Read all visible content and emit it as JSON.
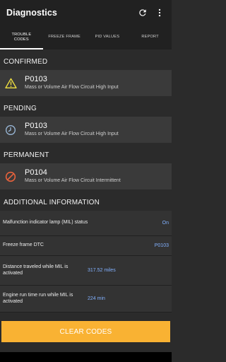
{
  "app": {
    "title": "Diagnostics"
  },
  "icons": {
    "refresh": "refresh-icon",
    "menu": "more-vert-icon"
  },
  "tabs": [
    {
      "label": "TROUBLE\nCODES",
      "active": true
    },
    {
      "label": "FREEZE FRAME"
    },
    {
      "label": "PID VALUES"
    },
    {
      "label": "REPORT"
    }
  ],
  "sections": {
    "confirmed": {
      "title": "CONFIRMED",
      "code": "P0103",
      "description": "Mass or Volume Air Flow Circuit High Input",
      "icon": "warning-icon"
    },
    "pending": {
      "title": "PENDING",
      "code": "P0103",
      "description": "Mass or Volume Air Flow Circuit High Input",
      "icon": "clock-icon"
    },
    "permanent": {
      "title": "PERMANENT",
      "code": "P0104",
      "description": "Mass or Volume Air Flow Circuit Intermittent",
      "icon": "prohibited-icon"
    }
  },
  "additional": {
    "title": "ADDITIONAL INFORMATION",
    "rows": [
      {
        "label": "Malfunction indicator lamp (MIL) status",
        "value": "On"
      },
      {
        "label": "Freeze frame DTC",
        "value": "P0103"
      },
      {
        "label": "Distance traveled while MIL is activated",
        "value": "317.52 miles"
      },
      {
        "label": "Engine run time run while MIL is activated",
        "value": "224 min"
      }
    ]
  },
  "footer": {
    "clear_label": "CLEAR CODES"
  },
  "colors": {
    "accent": "#f9b233",
    "link": "#82b1ff",
    "warning": "#f0e040",
    "prohibited": "#e8623c"
  }
}
